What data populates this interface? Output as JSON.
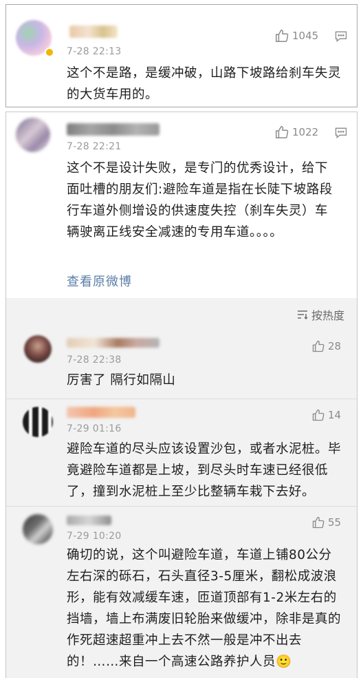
{
  "comments": [
    {
      "time": "7-28 22:13",
      "likes": "1045",
      "text": "这个不是路，是缓冲破，山路下坡路给刹车失灵的大货车用的。"
    },
    {
      "time": "7-28 22:21",
      "likes": "1022",
      "text": "这个不是设计失败，是专门的优秀设计，给下面吐槽的朋友们:避险车道是指在长陡下坡路段行车道外侧增设的供速度失控（刹车失灵）车辆驶离正线安全减速的专用车道。。。。",
      "view_original": "查看原微博"
    }
  ],
  "sort": {
    "label": "按热度"
  },
  "replies": [
    {
      "time": "7-28 22:38",
      "likes": "28",
      "text": "厉害了 隔行如隔山"
    },
    {
      "time": "7-29 01:16",
      "likes": "14",
      "text": "避险车道的尽头应该设置沙包，或者水泥桩。毕竟避险车道都是上坡，到尽头时车速已经很低了，撞到水泥桩上至少比整辆车栽下去好。"
    },
    {
      "time": "7-29 10:20",
      "likes": "55",
      "text": "确切的说，这个叫避险车道，车道上铺80公分左右深的砾石，石头直径3-5厘米，翻松成波浪形，能有效减缓车速，匝道顶部有1-2米左右的挡墙，墙上布满废旧轮胎来做缓冲，除非是真的作死超速超重冲上去不然一般是冲不出去的！……来自一个高速公路养护人员🙂"
    }
  ]
}
